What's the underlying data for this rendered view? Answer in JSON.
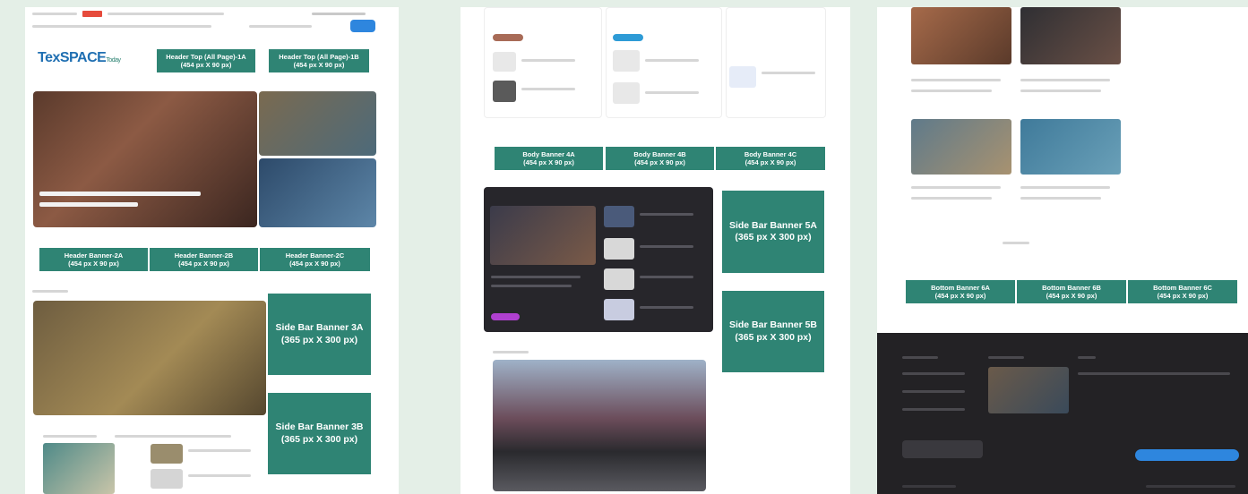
{
  "panel1": {
    "logo": "TexSPACE",
    "logo_sub": "Today",
    "banners": [
      {
        "title": "Header Top (All Page)-1A",
        "size": "(454 px X 90 px)"
      },
      {
        "title": "Header Top (All Page)-1B",
        "size": "(454 px X 90 px)"
      },
      {
        "title": "Header Banner-2A",
        "size": "(454 px X 90 px)"
      },
      {
        "title": "Header Banner-2B",
        "size": "(454 px X 90 px)"
      },
      {
        "title": "Header Banner-2C",
        "size": "(454 px X 90 px)"
      },
      {
        "title": "Side Bar Banner 3A",
        "size": "(365 px X 300 px)"
      },
      {
        "title": "Side Bar Banner 3B",
        "size": "(365 px X 300 px)"
      }
    ]
  },
  "panel2": {
    "banners": [
      {
        "title": "Body Banner 4A",
        "size": "(454 px X 90 px)"
      },
      {
        "title": "Body Banner 4B",
        "size": "(454 px X 90 px)"
      },
      {
        "title": "Body Banner 4C",
        "size": "(454 px X 90 px)"
      },
      {
        "title": "Side Bar Banner 5A",
        "size": "(365 px X 300 px)"
      },
      {
        "title": "Side Bar Banner 5B",
        "size": "(365 px X 300 px)"
      }
    ]
  },
  "panel3": {
    "banners": [
      {
        "title": "Bottom Banner 6A",
        "size": "(454 px X 90 px)"
      },
      {
        "title": "Bottom Banner 6B",
        "size": "(454 px X 90 px)"
      },
      {
        "title": "Bottom Banner 6C",
        "size": "(454 px X 90 px)"
      }
    ]
  },
  "colors": {
    "banner": "#2f8474",
    "background": "#e4efe7",
    "footer": "#232225"
  }
}
